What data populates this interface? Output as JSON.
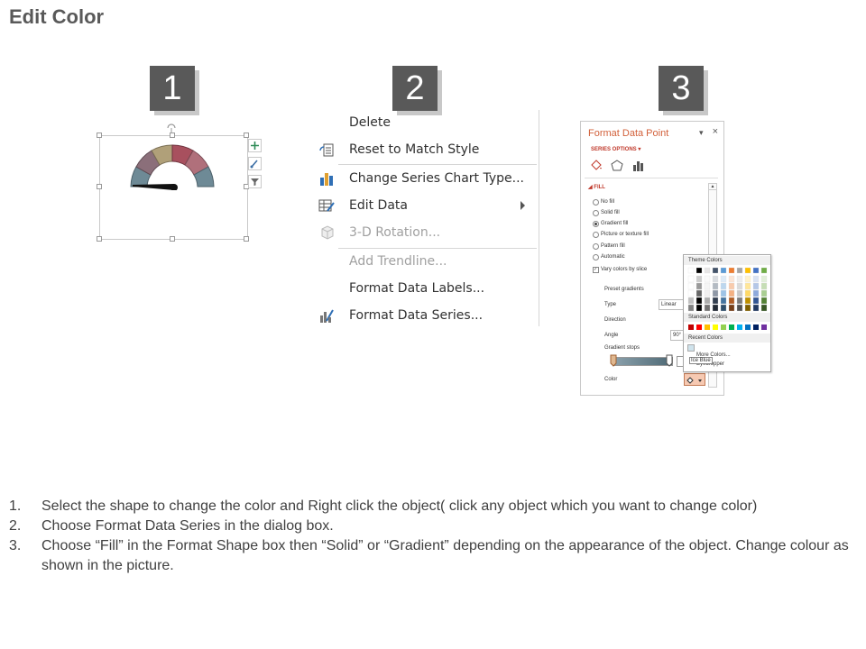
{
  "page_title": "Edit Color",
  "steps": [
    "1",
    "2",
    "3"
  ],
  "context_menu": {
    "items": [
      {
        "label": "Delete",
        "icon": "none",
        "disabled": false
      },
      {
        "label": "Reset to Match Style",
        "icon": "reset-style-icon",
        "disabled": false
      },
      {
        "label": "Change Series Chart Type...",
        "icon": "bar-chart-icon",
        "disabled": false
      },
      {
        "label": "Edit Data",
        "icon": "edit-data-icon",
        "disabled": false
      },
      {
        "label": "3-D Rotation...",
        "icon": "cube-icon",
        "disabled": true
      },
      {
        "label": "Add Trendline...",
        "icon": "none",
        "disabled": true
      },
      {
        "label": "Format Data Labels...",
        "icon": "none",
        "disabled": false
      },
      {
        "label": "Format Data Series...",
        "icon": "format-series-icon",
        "disabled": false
      }
    ]
  },
  "format_pane": {
    "title": "Format Data Point",
    "close": "×",
    "series_options": "SERIES OPTIONS",
    "fill_header": "FILL",
    "fill_options": [
      "No fill",
      "Solid fill",
      "Gradient fill",
      "Picture or texture fill",
      "Pattern fill",
      "Automatic"
    ],
    "selected_fill": "Gradient fill",
    "vary_colors": "Vary colors by slice",
    "preset_gradients": "Preset gradients",
    "type_label": "Type",
    "type_value": "Linear",
    "direction_label": "Direction",
    "angle_label": "Angle",
    "angle_value": "90°",
    "gradient_stops": "Gradient stops",
    "color_label": "Color"
  },
  "color_popup": {
    "theme_colors": "Theme Colors",
    "standard_colors": "Standard Colors",
    "recent_colors": "Recent Colors",
    "more_colors": "More Colors...",
    "eyedropper": "Eyedropper",
    "tooltip": "Ice Blue"
  },
  "colors": {
    "theme_top": [
      "#ffffff",
      "#000000",
      "#e7e6e6",
      "#44546a",
      "#5b9bd5",
      "#ed7d31",
      "#a5a5a5",
      "#ffc000",
      "#4472c4",
      "#70ad47"
    ],
    "standard": [
      "#c00000",
      "#ff0000",
      "#ffc000",
      "#ffff00",
      "#92d050",
      "#00b050",
      "#00b0f0",
      "#0070c0",
      "#002060",
      "#7030a0"
    ],
    "gauge": [
      "#6e8a96",
      "#8b6f7a",
      "#b0a079",
      "#a8505e",
      "#b0707b",
      "#6e8a96"
    ]
  },
  "instructions": [
    {
      "num": "1.",
      "text": "Select the shape to change the color and Right click the object( click any object which you want to change color)"
    },
    {
      "num": "2.",
      "text": "Choose Format Data Series in the dialog box."
    },
    {
      "num": "3.",
      "text": "Choose “Fill” in the Format Shape box then “Solid” or “Gradient” depending on the appearance of the object. Change colour as shown in the picture."
    }
  ]
}
